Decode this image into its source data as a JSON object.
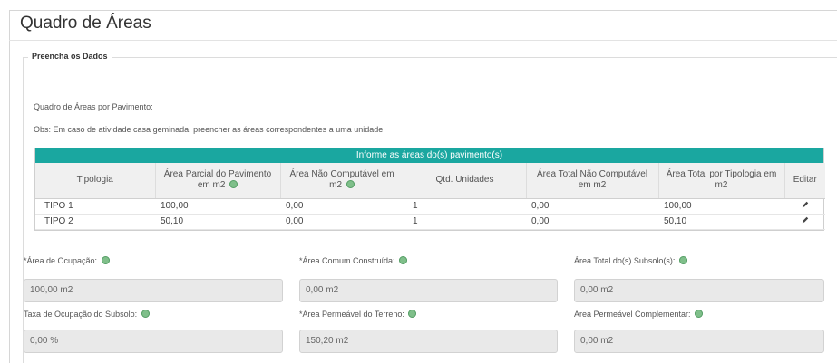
{
  "page": {
    "title": "Quadro de Áreas"
  },
  "section": {
    "legend": "Preencha os Dados",
    "subtitle": "Quadro de Áreas por Pavimento:",
    "note": "Obs: Em caso de atividade casa geminada, preencher as áreas correspondentes a uma unidade."
  },
  "grid": {
    "header": "Informe as áreas do(s) pavimento(s)",
    "accent_color": "#1aa7a0",
    "columns": [
      "Tipologia",
      "Área Parcial do Pavimento em m2",
      "Área Não Computável em m2",
      "Qtd. Unidades",
      "Área Total Não Computável em m2",
      "Área Total por Tipologia em m2",
      "Editar"
    ],
    "rows": [
      {
        "tipologia": "TIPO 1",
        "area_parcial": "100,00",
        "area_nao_comp": "0,00",
        "qtd": "1",
        "total_nao_comp": "0,00",
        "total_tipologia": "100,00",
        "edit_icon": "pencil-icon"
      },
      {
        "tipologia": "TIPO 2",
        "area_parcial": "50,10",
        "area_nao_comp": "0,00",
        "qtd": "1",
        "total_nao_comp": "0,00",
        "total_tipologia": "50,10",
        "edit_icon": "pencil-icon"
      }
    ]
  },
  "fields": {
    "area_ocupacao": {
      "label": "*Área de Ocupação:",
      "value": "100,00 m2"
    },
    "area_comum": {
      "label": "*Área Comum Construída:",
      "value": "0,00 m2"
    },
    "area_subsolo": {
      "label": "Área Total do(s) Subsolo(s):",
      "value": "0,00 m2"
    },
    "taxa_subsolo": {
      "label": "Taxa de Ocupação do Subsolo:",
      "value": "0,00 %"
    },
    "area_permeavel": {
      "label": "*Área Permeável do Terreno:",
      "value": "150,20 m2"
    },
    "area_perm_compl": {
      "label": "Área Permeável Complementar:",
      "value": "0,00 m2"
    }
  }
}
